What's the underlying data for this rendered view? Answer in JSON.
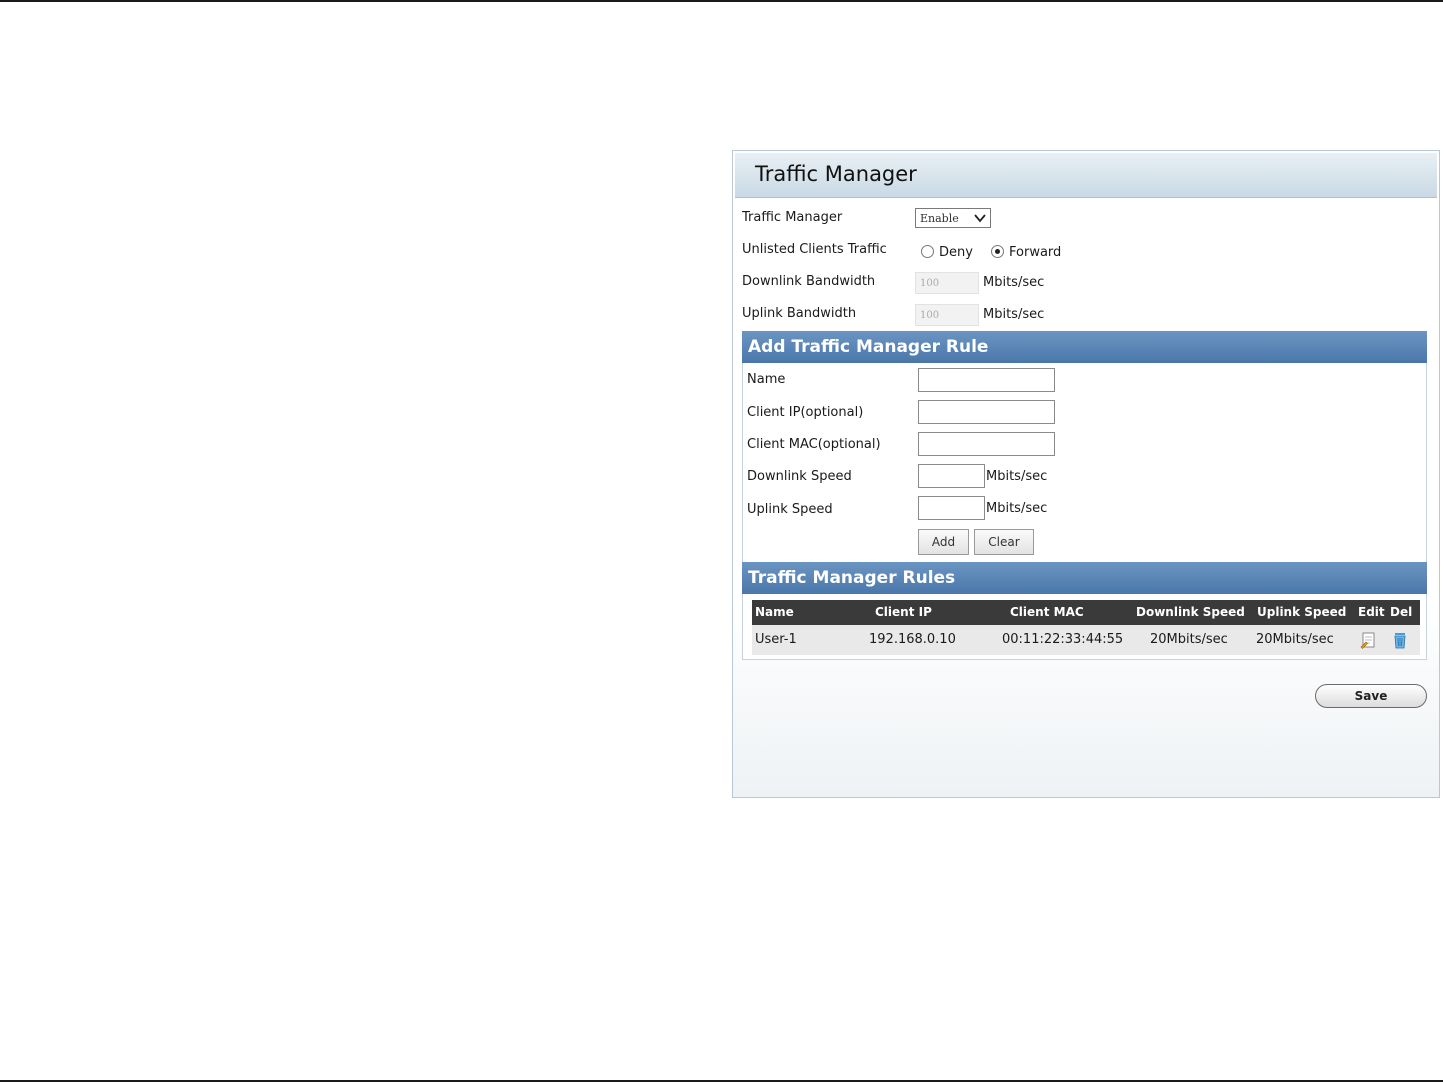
{
  "panel": {
    "title": "Traffic Manager"
  },
  "settings": {
    "traffic_manager": {
      "label": "Traffic Manager",
      "value": "Enable"
    },
    "unlisted_clients": {
      "label": "Unlisted Clients Traffic",
      "deny_label": "Deny",
      "forward_label": "Forward",
      "selected": "Forward"
    },
    "downlink_bandwidth": {
      "label": "Downlink Bandwidth",
      "value": "100",
      "unit": "Mbits/sec"
    },
    "uplink_bandwidth": {
      "label": "Uplink Bandwidth",
      "value": "100",
      "unit": "Mbits/sec"
    }
  },
  "add_rule": {
    "title": "Add Traffic Manager Rule",
    "name_label": "Name",
    "client_ip_label": "Client IP(optional)",
    "client_mac_label": "Client MAC(optional)",
    "downlink_label": "Downlink Speed",
    "downlink_unit": "Mbits/sec",
    "uplink_label": "Uplink Speed",
    "uplink_unit": "Mbits/sec",
    "add_label": "Add",
    "clear_label": "Clear"
  },
  "rules": {
    "title": "Traffic Manager Rules",
    "headers": [
      "Name",
      "Client IP",
      "Client MAC",
      "Downlink Speed",
      "Uplink Speed",
      "Edit",
      "Del"
    ],
    "rows": [
      [
        "User-1",
        "192.168.0.10",
        "00:11:22:33:44:55",
        "20Mbits/sec",
        "20Mbits/sec"
      ]
    ],
    "edit_icon": "edit-icon",
    "delete_icon": "trash-icon"
  },
  "save_label": "Save"
}
